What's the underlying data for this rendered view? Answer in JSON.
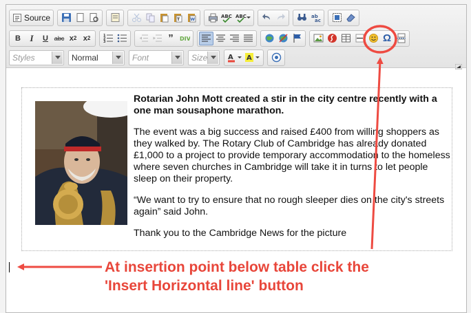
{
  "toolbar": {
    "source_label": "Source",
    "styles_placeholder": "Styles",
    "format_value": "Normal",
    "font_placeholder": "Font",
    "size_placeholder": "Size",
    "bold_label": "B",
    "italic_label": "I",
    "underline_label": "U",
    "strike_label": "abc",
    "subscript_label": "x",
    "subscript_sub": "2",
    "superscript_label": "x",
    "superscript_sup": "2",
    "highlighted_button": "horizontal-line-button"
  },
  "document": {
    "lead": "Rotarian John Mott created a stir in the city centre recently with a one man sousaphone marathon.",
    "paragraph_1": "The event was a big success and raised £400 from  willing shoppers as they walked by. The Rotary Club of Cambridge has already donated £1,000 to a project to provide temporary accommodation to the homeless where seven churches in Cambridge will take it in turns to let people sleep on their property.",
    "paragraph_2": "“We want to try to ensure that no rough sleeper dies on the city's streets again”  said John.",
    "paragraph_3": "Thank you to the Cambridge News for the picture"
  },
  "annotation": {
    "line_1": "At insertion point below table click the",
    "line_2": "'Insert Horizontal line' button",
    "color": "#e8463a"
  }
}
